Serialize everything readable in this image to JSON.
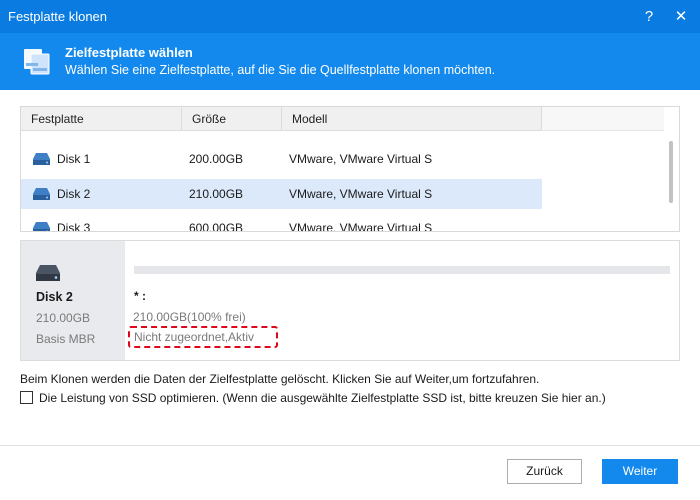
{
  "window": {
    "title": "Festplatte klonen",
    "help": "?",
    "close": "✕"
  },
  "header": {
    "title": "Zielfestplatte wählen",
    "subtitle": "Wählen Sie eine Zielfestplatte, auf die Sie die Quellfestplatte klonen möchten."
  },
  "table": {
    "columns": [
      "Festplatte",
      "Größe",
      "Modell"
    ],
    "rows": [
      {
        "name": "Disk 1",
        "size": "200.00GB",
        "model": "VMware, VMware Virtual S",
        "selected": false
      },
      {
        "name": "Disk 2",
        "size": "210.00GB",
        "model": "VMware, VMware Virtual S",
        "selected": true
      },
      {
        "name": "Disk 3",
        "size": "600.00GB",
        "model": "VMware, VMware Virtual S",
        "selected": false
      }
    ]
  },
  "detail": {
    "disk_name": "Disk 2",
    "disk_size": "210.00GB",
    "disk_type": "Basis MBR",
    "partition_label": "* :",
    "partition_free": "210.00GB(100% frei)",
    "partition_status": "Nicht zugeordnet,Aktiv"
  },
  "notice": "Beim Klonen werden die Daten der Zielfestplatte gelöscht. Klicken Sie auf Weiter,um fortzufahren.",
  "ssd_option": {
    "label": "Die Leistung von SSD optimieren. (Wenn die ausgewählte Zielfestplatte SSD ist, bitte kreuzen Sie hier an.)",
    "checked": false
  },
  "buttons": {
    "back": "Zurück",
    "next": "Weiter"
  },
  "colors": {
    "accent": "#1389ee",
    "titlebar": "#0a7be0",
    "selection": "#dbe9fb",
    "highlight_dash": "#e0061a"
  },
  "icons": {
    "header": "disk-clone-icon",
    "disk": "hard-disk-icon"
  }
}
